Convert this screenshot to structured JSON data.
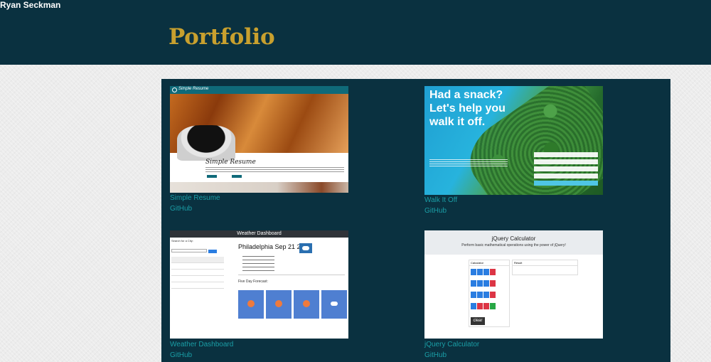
{
  "header": {
    "brand": "Ryan Seckman",
    "title": "Portfolio"
  },
  "projects": [
    {
      "name": "Simple Resume",
      "github": "GitHub",
      "thumb": {
        "nav_title": "Simple Resume",
        "heading": "Simple Resume"
      }
    },
    {
      "name": "Walk It Off",
      "github": "GitHub",
      "thumb": {
        "headline": "Had a snack? Let's help you walk it off."
      }
    },
    {
      "name": "Weather Dashboard",
      "github": "GitHub",
      "thumb": {
        "app_title": "Weather Dashboard",
        "search_label": "Search for a City:",
        "city_heading": "Philadelphia Sep 21 2020",
        "forecast_label": "Five Day Forecast:"
      }
    },
    {
      "name": "jQuery Calculator",
      "github": "GitHub",
      "thumb": {
        "title": "jQuery Calculator",
        "subtitle": "Perform basic mathematical operations using the power of jQuery!",
        "calc_label": "Calculator",
        "result_label": "Result",
        "clear_label": "clear"
      }
    }
  ],
  "colors": {
    "header_bg": "#0a3140",
    "title_gold": "#c8a02e",
    "link_teal": "#1a9ea6",
    "panel_bg": "#0a3140"
  }
}
